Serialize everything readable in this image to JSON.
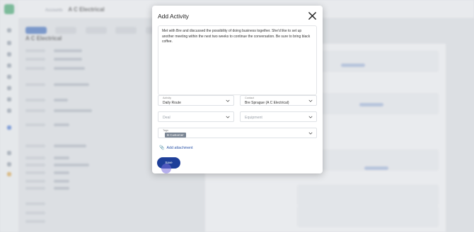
{
  "background": {
    "breadcrumb": "Accounts",
    "account_name": "A C Electrical"
  },
  "modal": {
    "title": "Add Activity",
    "notes": "Met with Bre and discussed the possibility of doing business together. She'd like to set up another meeting within the next two weeks to continue the conversation. Be sure to bring black coffee.",
    "activity": {
      "label": "Activity",
      "value": "Daily Route"
    },
    "contact": {
      "label": "Contact",
      "value": "Bre Sprague (A C Electrical)"
    },
    "deal": {
      "placeholder": "Deal"
    },
    "equipment": {
      "placeholder": "Equipment"
    },
    "tags": {
      "label": "Tags",
      "values": [
        "B Customer"
      ]
    },
    "add_attachment": "Add attachment",
    "save_label": "Save"
  },
  "colors": {
    "primary_button": "#1e3f99",
    "link": "#2c55a8",
    "tag": "#7a8593"
  }
}
